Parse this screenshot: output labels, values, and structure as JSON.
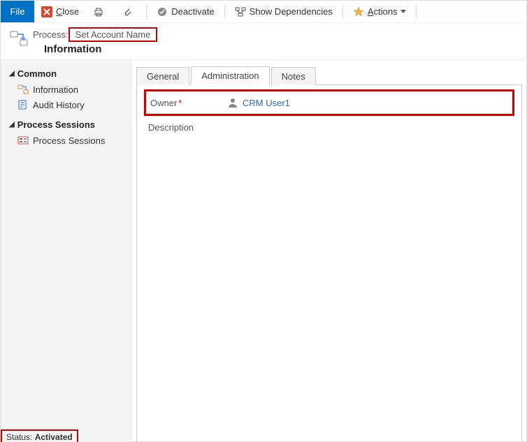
{
  "toolbar": {
    "file_label": "File",
    "close_label": "Close",
    "deactivate_label": "Deactivate",
    "show_deps_label": "Show Dependencies",
    "actions_label": "Actions"
  },
  "header": {
    "process_label": "Process:",
    "process_name": "Set Account Name",
    "subtitle": "Information"
  },
  "sidebar": {
    "groups": [
      {
        "title": "Common",
        "items": [
          {
            "label": "Information",
            "icon": "process-icon"
          },
          {
            "label": "Audit History",
            "icon": "audit-icon"
          }
        ]
      },
      {
        "title": "Process Sessions",
        "items": [
          {
            "label": "Process Sessions",
            "icon": "sessions-icon"
          }
        ]
      }
    ]
  },
  "tabs": [
    "General",
    "Administration",
    "Notes"
  ],
  "active_tab": "Administration",
  "form": {
    "owner_label": "Owner",
    "owner_value": "CRM User1",
    "description_label": "Description"
  },
  "status": {
    "label": "Status:",
    "value": "Activated"
  },
  "colors": {
    "brand": "#0171c5",
    "highlight": "#c00",
    "link": "#2a6bbf"
  }
}
